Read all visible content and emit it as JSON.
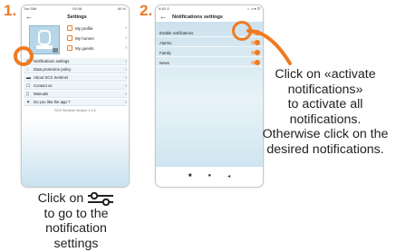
{
  "step1": {
    "number": "1.",
    "statusbar": {
      "left": "No SIM",
      "center": "09:38",
      "right": "60 %"
    },
    "header_title": "Settings",
    "profile_links": [
      "My profile",
      "My homes",
      "My guests"
    ],
    "menu": [
      {
        "icon": "⚙",
        "label": "Notifications settings"
      },
      {
        "icon": "◌",
        "label": "Data protection policy"
      },
      {
        "icon": "▬",
        "label": "About SCS Sentinel"
      },
      {
        "icon": "☐",
        "label": "Contact us"
      },
      {
        "icon": "▯",
        "label": "Manuals"
      },
      {
        "icon": "✦",
        "label": "Do you like the app ?"
      }
    ],
    "version": "SCS Sentinel Version 1.0.0",
    "caption": {
      "line1": "Click on",
      "line2": "to go to the",
      "line3": "notification",
      "line4": "settings"
    }
  },
  "step2": {
    "number": "2.",
    "statusbar": {
      "left": "9:45 ⊙",
      "right": "⌂ .ıl ▾ ⊡"
    },
    "header_title": "Notifications settings",
    "rows": [
      "Enable notifications",
      "Alarms",
      "Family",
      "News"
    ],
    "nav": [
      "■",
      "●",
      "◂"
    ],
    "caption": [
      "Click on «activate",
      "notifications»",
      "to activate all",
      "notifications.",
      "Otherwise click on the",
      "desired notifications."
    ]
  },
  "colors": {
    "accent": "#f07a21"
  }
}
